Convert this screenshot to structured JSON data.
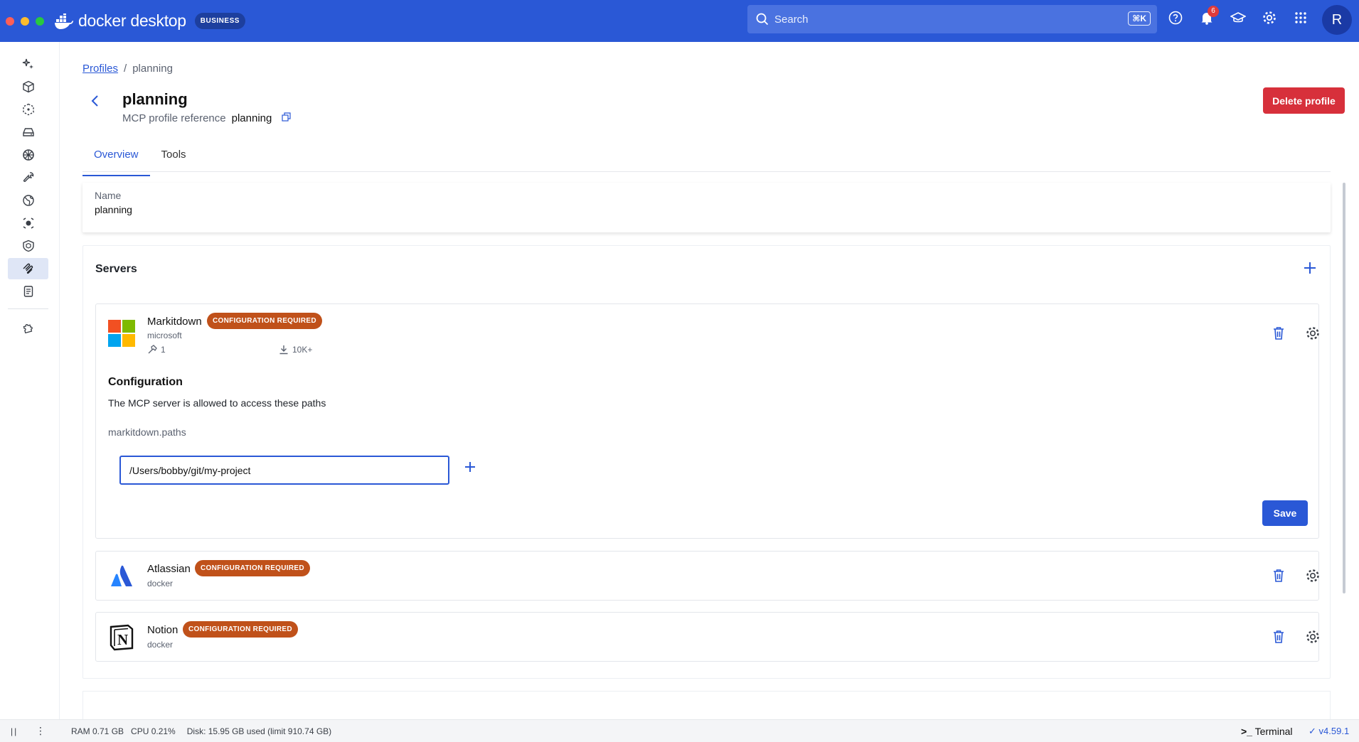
{
  "app": {
    "name": "docker desktop",
    "plan_badge": "BUSINESS"
  },
  "topbar": {
    "search_placeholder": "Search",
    "search_shortcut": "⌘K",
    "notification_count": "6",
    "avatar_initial": "R"
  },
  "breadcrumb": {
    "parent": "Profiles",
    "current": "planning"
  },
  "header": {
    "title": "planning",
    "ref_label": "MCP profile reference",
    "ref_value": "planning",
    "delete_label": "Delete profile"
  },
  "tabs": [
    {
      "label": "Overview",
      "active": true
    },
    {
      "label": "Tools",
      "active": false
    }
  ],
  "profile": {
    "name_label": "Name",
    "name_value": "planning"
  },
  "servers": {
    "title": "Servers",
    "items": [
      {
        "name": "Markitdown",
        "tag": "CONFIGURATION REQUIRED",
        "publisher": "microsoft",
        "tools_count": "1",
        "downloads": "10K+",
        "config": {
          "title": "Configuration",
          "description": "The MCP server is allowed to access these paths",
          "key": "markitdown.paths",
          "path_value": "/Users/bobby/git/my-project",
          "save_label": "Save"
        }
      },
      {
        "name": "Atlassian",
        "tag": "CONFIGURATION REQUIRED",
        "publisher": "docker"
      },
      {
        "name": "Notion",
        "tag": "CONFIGURATION REQUIRED",
        "publisher": "docker"
      }
    ]
  },
  "statusbar": {
    "ram": "RAM 0.71 GB",
    "cpu": "CPU 0.21%",
    "disk": "Disk: 15.95 GB used (limit 910.74 GB)",
    "terminal": "Terminal",
    "version": "v4.59.1"
  },
  "colors": {
    "brand": "#2a58d6",
    "danger": "#d7303b",
    "warning_tag": "#c0511a"
  }
}
